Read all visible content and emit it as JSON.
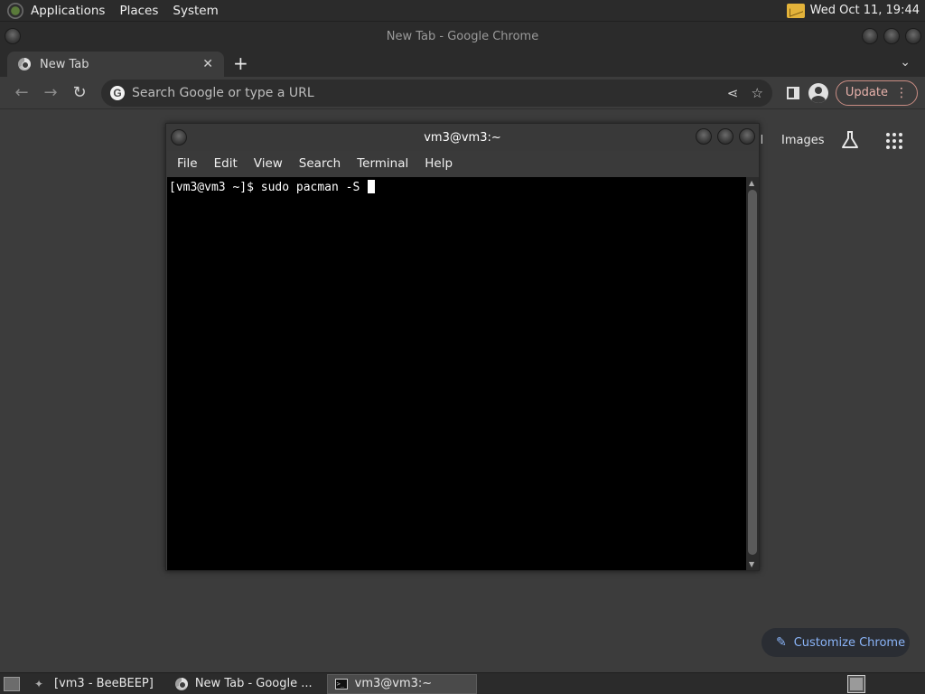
{
  "top_panel": {
    "menus": [
      "Applications",
      "Places",
      "System"
    ],
    "clock": "Wed Oct 11, 19:44"
  },
  "chrome": {
    "window_title": "New Tab - Google Chrome",
    "tab": {
      "label": "New Tab",
      "close": "✕"
    },
    "new_tab": "+",
    "tab_search": "⌄",
    "omnibox_placeholder": "Search Google or type a URL",
    "update_label": "Update",
    "ntp": {
      "gmail_fragment": "ail",
      "images_label": "Images",
      "customize_label": "Customize Chrome"
    }
  },
  "terminal": {
    "title": "vm3@vm3:~",
    "menu": [
      "File",
      "Edit",
      "View",
      "Search",
      "Terminal",
      "Help"
    ],
    "prompt": "[vm3@vm3 ~]$ sudo pacman -S "
  },
  "taskbar": {
    "items": [
      "[vm3 - BeeBEEP]",
      "New Tab - Google ...",
      "vm3@vm3:~"
    ]
  },
  "colors": {
    "accent_blue": "#8ab4f8",
    "update_pink": "#e8b2ab",
    "terminal_bg": "#000000"
  }
}
